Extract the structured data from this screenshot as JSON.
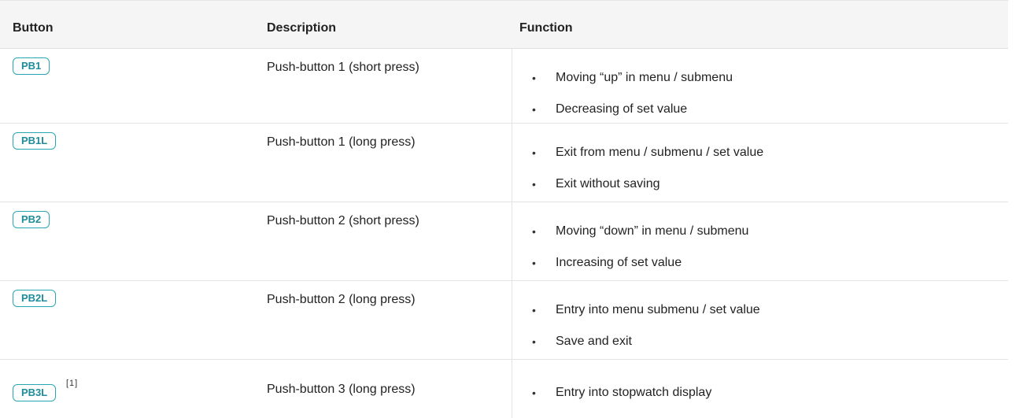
{
  "headers": {
    "button": "Button",
    "description": "Description",
    "function": "Function"
  },
  "rows": [
    {
      "button": "PB1",
      "footnote": "",
      "description": "Push-button 1 (short press)",
      "functions": [
        "Moving “up” in menu / submenu",
        "Decreasing of set value"
      ]
    },
    {
      "button": "PB1L",
      "footnote": "",
      "description": "Push-button 1 (long press)",
      "functions": [
        "Exit from menu / submenu / set value",
        "Exit without saving"
      ]
    },
    {
      "button": "PB2",
      "footnote": "",
      "description": "Push-button 2 (short press)",
      "functions": [
        "Moving “down” in menu / submenu",
        "Increasing of set value"
      ]
    },
    {
      "button": "PB2L",
      "footnote": "",
      "description": "Push-button 2 (long press)",
      "functions": [
        "Entry into menu submenu / set value",
        "Save and exit"
      ]
    },
    {
      "button": "PB3L",
      "footnote": "[1]",
      "description": "Push-button 3 (long press)",
      "functions": [
        "Entry into stopwatch display"
      ]
    }
  ],
  "bullet_char": "•",
  "colors": {
    "badge_border": "#2aa6b3",
    "badge_text": "#1f8c99",
    "header_bg": "#f5f5f5"
  }
}
